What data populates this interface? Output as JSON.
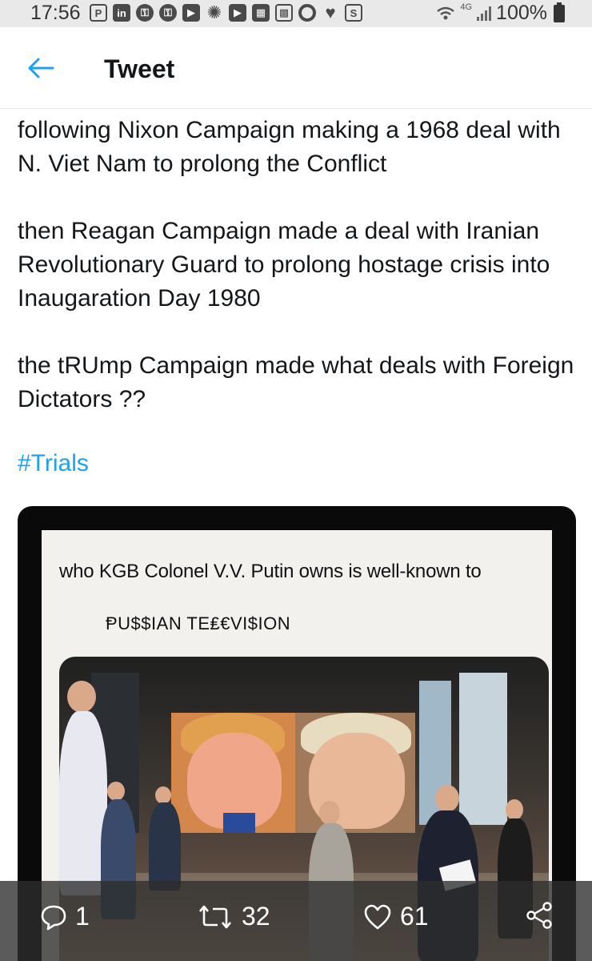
{
  "status_bar": {
    "time": "17:56",
    "network": "4G",
    "battery": "100%",
    "icons": [
      "payment-icon",
      "linkedin-icon",
      "lock-icon",
      "lock-icon",
      "youtube-icon",
      "sun-icon",
      "video-icon",
      "gallery-icon",
      "qr-icon",
      "circle-icon",
      "heart-icon",
      "shield-icon",
      "wifi-icon",
      "signal-icon",
      "battery-icon"
    ]
  },
  "header": {
    "back_icon": "back-arrow-icon",
    "title": "Tweet"
  },
  "tweet": {
    "paragraphs": [
      "following Nixon Campaign making a 1968 deal with N. Viet Nam to prolong the Conflict",
      "then Reagan Campaign made a deal with Iranian Revolutionary Guard to prolong hostage crisis into Inaugaration Day 1980",
      "the tRUmp Campaign made what deals with Foreign Dictators ??"
    ],
    "hashtag": "#Trials",
    "hashtag_color": "#1da1f2"
  },
  "media": {
    "caption_line_1": "who KGB Colonel V.V. Putin owns is well-known to",
    "caption_line_2": "ⱣU$$IAN TE₤€VI$ION"
  },
  "actions": {
    "reply_count": "1",
    "retweet_count": "32",
    "like_count": "61",
    "reply_icon": "reply-icon",
    "retweet_icon": "retweet-icon",
    "like_icon": "heart-icon",
    "share_icon": "share-icon"
  },
  "colors": {
    "accent": "#1da1f2",
    "text": "#14171a",
    "status_bar_bg": "#e9e9e9"
  }
}
